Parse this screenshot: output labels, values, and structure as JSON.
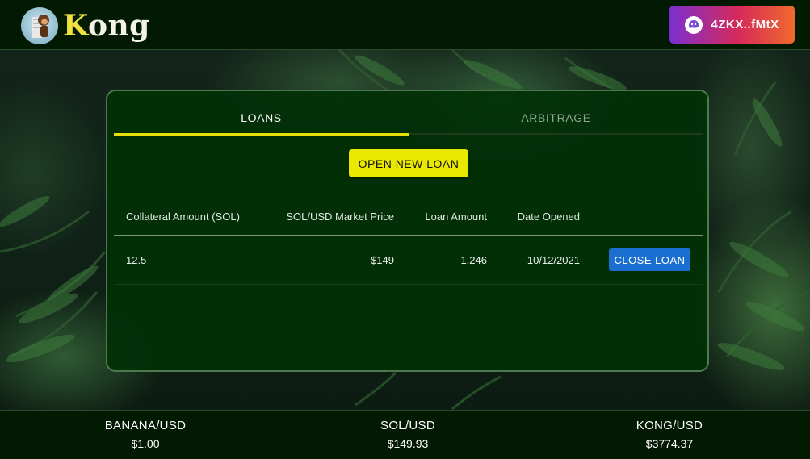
{
  "header": {
    "brand": {
      "first_letter": "K",
      "rest": "ong"
    },
    "wallet": {
      "label": "4ZKX..fMtX",
      "icon": "ghost-icon"
    }
  },
  "tabs": [
    {
      "label": "LOANS",
      "active": true
    },
    {
      "label": "ARBITRAGE",
      "active": false
    }
  ],
  "loans": {
    "open_button": "OPEN NEW LOAN",
    "columns": [
      "Collateral Amount (SOL)",
      "SOL/USD Market Price",
      "Loan Amount",
      "Date Opened"
    ],
    "rows": [
      {
        "collateral": "12.5",
        "price": "$149",
        "amount": "1,246",
        "date": "10/12/2021",
        "action": "CLOSE LOAN"
      }
    ]
  },
  "footer": {
    "tickers": [
      {
        "pair": "BANANA/USD",
        "price": "$1.00"
      },
      {
        "pair": "SOL/USD",
        "price": "$149.93"
      },
      {
        "pair": "KONG/USD",
        "price": "$3774.37"
      }
    ]
  },
  "colors": {
    "accent_yellow": "#e8e800",
    "close_button_blue": "#1a6fd0",
    "header_bg": "#021a02",
    "card_bg": "#02300a"
  }
}
